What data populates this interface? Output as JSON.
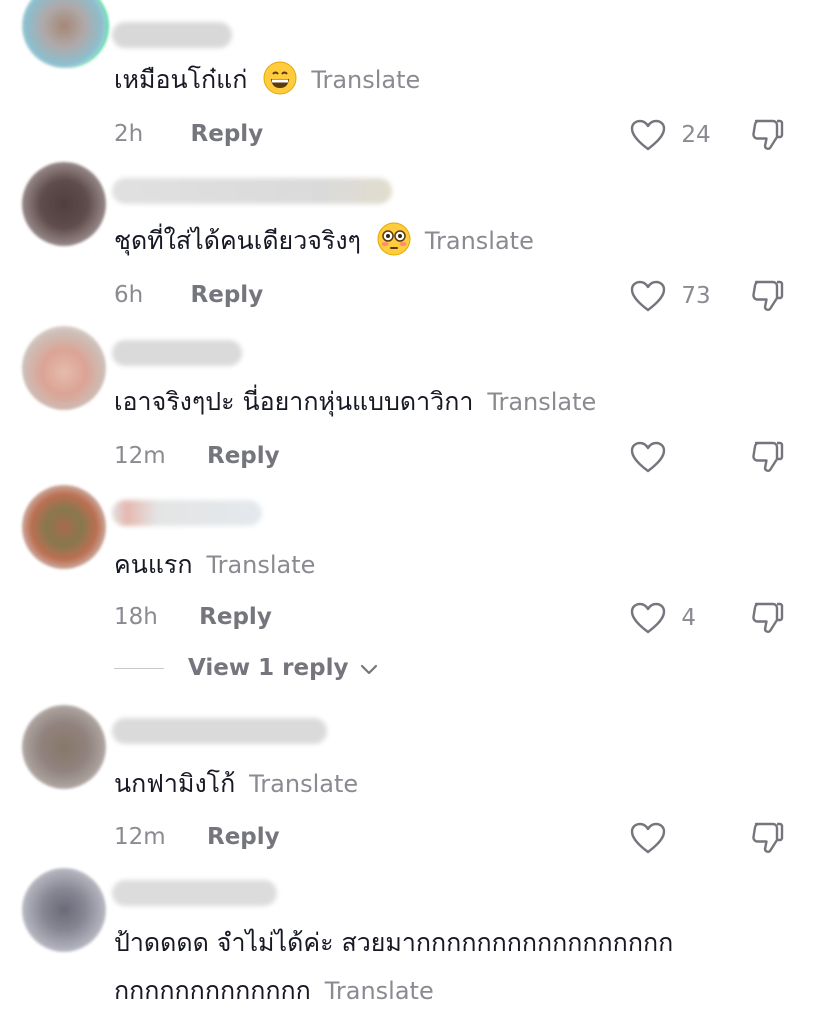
{
  "translate_label": "Translate",
  "reply_label": "Reply",
  "comments": [
    {
      "text": "เหมือนโก๋แก่",
      "emoji": "grinning-face",
      "time": "2h",
      "likes": "24",
      "avatar_colors": [
        "#9b7b68",
        "#7fb8c9",
        "#4ed9a0"
      ],
      "username_color": "#b9b9b9"
    },
    {
      "text": "ชุดที่ใส่ได้คนเดียวจริงๆ",
      "emoji": "flushed-face",
      "time": "6h",
      "likes": "73",
      "avatar_colors": [
        "#3b2a28",
        "#6b5a5a",
        "#9c8a8a"
      ],
      "username_color": "#b8b4a6"
    },
    {
      "text": "เอาจริงๆปะ นี่อยากหุ่นแบบดาวิกา",
      "emoji": "",
      "time": "12m",
      "likes": "",
      "avatar_colors": [
        "#e3b5a5",
        "#c98a80",
        "#d9d0cb"
      ],
      "username_color": "#bcbcbc"
    },
    {
      "text": "คนแรก",
      "emoji": "",
      "time": "18h",
      "likes": "4",
      "avatar_colors": [
        "#9e5a3a",
        "#5f7a3c",
        "#c9503c"
      ],
      "username_color": "#c9a8a8"
    },
    {
      "text": "นกฟามิงโก้",
      "emoji": "",
      "time": "12m",
      "likes": "",
      "avatar_colors": [
        "#7a6a5a",
        "#8a7f7a",
        "#a89c95"
      ],
      "username_color": "#bdbdbd"
    },
    {
      "text_line1": "ป้าดดดด จำไม่ได้ค่ะ สวยมากกกกกกกกกกกกกกกกก",
      "text_line2": "กกกกกกกกกกกกก",
      "avatar_colors": [
        "#5a5a6a",
        "#9a9aa8",
        "#cfcfd6"
      ],
      "username_color": "#c0c0c0"
    }
  ],
  "view_replies": "View 1 reply"
}
